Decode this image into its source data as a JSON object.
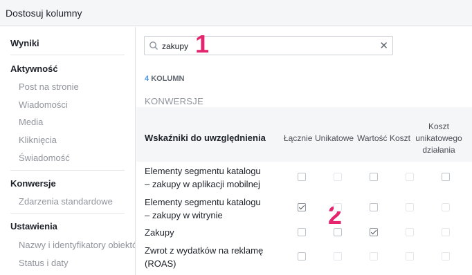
{
  "header": {
    "title": "Dostosuj kolumny"
  },
  "sidebar": {
    "results": "Wyniki",
    "activity": {
      "label": "Aktywność",
      "items": [
        "Post na stronie",
        "Wiadomości",
        "Media",
        "Kliknięcia",
        "Świadomość"
      ]
    },
    "conversions": {
      "label": "Konwersje",
      "items": [
        "Zdarzenia standardowe"
      ]
    },
    "settings": {
      "label": "Ustawienia",
      "items": [
        "Nazwy i identyfikatory obiektów",
        "Status i daty"
      ]
    }
  },
  "search": {
    "value": "zakupy"
  },
  "annotations": {
    "one": "1",
    "two": "2"
  },
  "summary": {
    "count": "4",
    "label": "KOLUMN"
  },
  "section_title": "KONWERSJE",
  "table": {
    "metric_header": "Wskaźniki do uwzględnienia",
    "columns": [
      "Łącznie",
      "Unikatowe",
      "Wartość",
      "Koszt",
      "Koszt\nunikatowego\ndziałania"
    ],
    "rows": [
      {
        "label": "Elementy segmentu katalogu\n– zakupy w aplikacji mobilnej",
        "checks": [
          "off",
          "dim",
          "off",
          "dim",
          "off"
        ]
      },
      {
        "label": "Elementy segmentu katalogu\n– zakupy w witrynie",
        "checks": [
          "on",
          "dim",
          "off",
          "dim",
          "dim"
        ]
      },
      {
        "label": "Zakupy",
        "checks": [
          "off",
          "off",
          "on",
          "dim",
          "dim"
        ]
      },
      {
        "label": "Zwrot z wydatków na reklamę\n(ROAS)",
        "checks": [
          "off",
          "dim",
          "dim",
          "dim",
          "dim"
        ]
      }
    ]
  }
}
